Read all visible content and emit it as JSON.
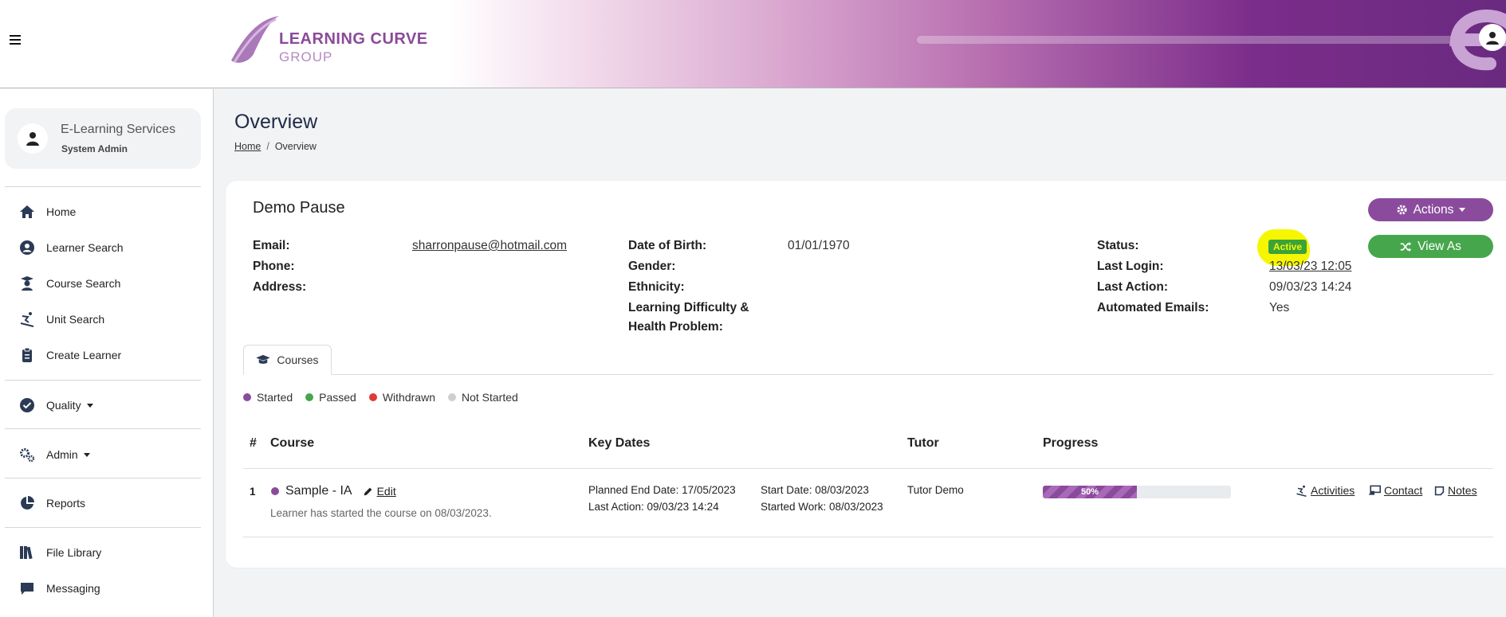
{
  "header": {
    "logo_line1": "LEARNING CURVE",
    "logo_line2": "GROUP",
    "menu_icon": "hamburger-icon",
    "account_icon": "user-icon"
  },
  "sidebar": {
    "user": {
      "name": "E-Learning Services",
      "role": "System Admin"
    },
    "items": [
      {
        "label": "Home",
        "icon": "home-icon"
      },
      {
        "label": "Learner Search",
        "icon": "user-circle-icon"
      },
      {
        "label": "Course Search",
        "icon": "graduate-icon"
      },
      {
        "label": "Unit Search",
        "icon": "skiing-icon"
      },
      {
        "label": "Create Learner",
        "icon": "clipboard-icon"
      },
      {
        "label": "Quality",
        "icon": "check-circle-icon"
      },
      {
        "label": "Admin",
        "icon": "cogs-icon"
      },
      {
        "label": "Reports",
        "icon": "pie-chart-icon"
      },
      {
        "label": "File Library",
        "icon": "books-icon"
      },
      {
        "label": "Messaging",
        "icon": "comment-icon"
      }
    ]
  },
  "page": {
    "title": "Overview",
    "breadcrumb": {
      "home": "Home",
      "separator": "/",
      "current": "Overview"
    }
  },
  "learner": {
    "name": "Demo Pause",
    "email_label": "Email:",
    "email": "sharronpause@hotmail.com",
    "phone_label": "Phone:",
    "address_label": "Address:",
    "dob_label": "Date of Birth:",
    "dob": "01/01/1970",
    "gender_label": "Gender:",
    "ethnicity_label": "Ethnicity:",
    "ldd_label_line1": "Learning Difficulty &",
    "ldd_label_line2": "Health Problem:",
    "status_label": "Status:",
    "status": "Active",
    "last_login_label": "Last Login:",
    "last_login": "13/03/23 12:05",
    "last_action_label": "Last Action:",
    "last_action": "09/03/23 14:24",
    "auto_emails_label": "Automated Emails:",
    "auto_emails": "Yes"
  },
  "buttons": {
    "actions": "Actions",
    "view_as": "View As"
  },
  "tabs": [
    {
      "label": "Courses",
      "icon": "graduation-cap-icon"
    }
  ],
  "legend": [
    {
      "label": "Started",
      "color": "#8b4b9d"
    },
    {
      "label": "Passed",
      "color": "#46a64c"
    },
    {
      "label": "Withdrawn",
      "color": "#e03a3a"
    },
    {
      "label": "Not Started",
      "color": "#cfcfcf"
    }
  ],
  "table": {
    "headers": {
      "num": "#",
      "course": "Course",
      "key_dates": "Key Dates",
      "tutor": "Tutor",
      "progress": "Progress"
    },
    "rows": [
      {
        "num": "1",
        "course": "Sample - IA",
        "edit": "Edit",
        "note": "Learner has started the course on 08/03/2023.",
        "planned_end": "Planned End Date: 17/05/2023",
        "last_action": "Last Action: 09/03/23 14:24",
        "start_date": "Start Date: 08/03/2023",
        "started_work": "Started Work: 08/03/2023",
        "tutor": "Tutor Demo",
        "progress_label": "50%",
        "progress_value": 0.5,
        "actions": {
          "activities": "Activities",
          "contact": "Contact",
          "notes": "Notes"
        }
      }
    ]
  }
}
